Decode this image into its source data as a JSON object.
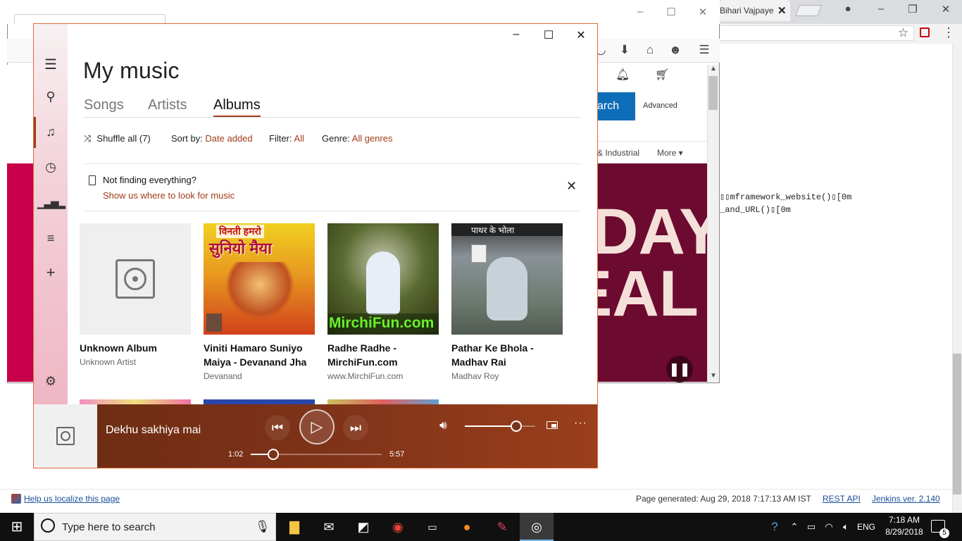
{
  "chrome": {
    "tab_title": "Bihari Vajpaye",
    "console_lines": [
      "▯▯mframework_website()▯[0m",
      "_and_URL()▯[0m"
    ]
  },
  "firefox": {
    "search_label": "arch",
    "advanced_label": "Advanced",
    "nav_item": "& Industrial",
    "more_label": "More",
    "banner_line1": "DAY",
    "banner_line2": "EAL"
  },
  "groove": {
    "title": "My music",
    "tabs": [
      {
        "label": "Songs"
      },
      {
        "label": "Artists"
      },
      {
        "label": "Albums"
      }
    ],
    "shuffle_label": "Shuffle all (7)",
    "sort_label": "Sort by:",
    "sort_value": "Date added",
    "filter_label": "Filter:",
    "filter_value": "All",
    "genre_label": "Genre:",
    "genre_value": "All genres",
    "notice_title": "Not finding everything?",
    "notice_link": "Show us where to look for music",
    "albums": [
      {
        "name": "Unknown Album",
        "artist": "Unknown Artist"
      },
      {
        "name": "Viniti Hamaro Suniyo Maiya - Devanand Jha",
        "artist": "Devanand"
      },
      {
        "name": "Radhe Radhe - MirchiFun.com",
        "artist": "www.MirchiFun.com"
      },
      {
        "name": "Pathar Ke Bhola - Madhav Rai",
        "artist": "Madhav Roy"
      }
    ],
    "cover_texts": {
      "viniti_line1": "विनती हमरो",
      "viniti_line2": "सुनियो मैया",
      "mirchifun": "MirchiFun.com",
      "pathar": "पाथर के भोला"
    },
    "player": {
      "now_playing": "Dekhu sakhiya mai",
      "elapsed": "1:02",
      "duration": "5:57",
      "progress": 0.17,
      "volume": 0.75
    }
  },
  "footer": {
    "localize_link": "Help us localize this page",
    "generated": "Page generated: Aug 29, 2018 7:17:13 AM IST",
    "rest_api": "REST API",
    "jenkins": "Jenkins ver. 2.140"
  },
  "taskbar": {
    "search_placeholder": "Type here to search",
    "language": "ENG",
    "time": "7:18 AM",
    "date": "8/29/2018",
    "notification_count": "5"
  }
}
